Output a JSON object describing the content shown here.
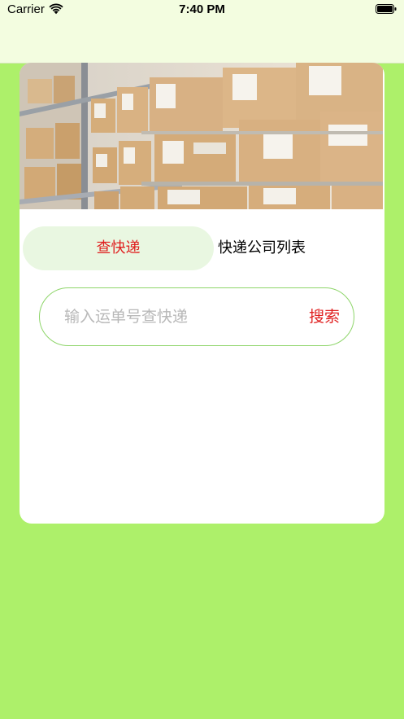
{
  "status_bar": {
    "carrier": "Carrier",
    "time": "7:40 PM",
    "wifi_icon": "wifi-icon",
    "battery_icon": "battery-icon"
  },
  "colors": {
    "background": "#adf06a",
    "header": "#f3fde0",
    "accent": "#e02020",
    "tab_active_bg": "#e9f7e1",
    "search_border": "#8ed56a"
  },
  "banner": {
    "image": "warehouse shelves with cardboard boxes"
  },
  "tabs": [
    {
      "label": "查快递",
      "active": true
    },
    {
      "label": "快递公司列表",
      "active": false
    }
  ],
  "search": {
    "placeholder": "输入运单号查快递",
    "value": "",
    "button_label": "搜索"
  }
}
